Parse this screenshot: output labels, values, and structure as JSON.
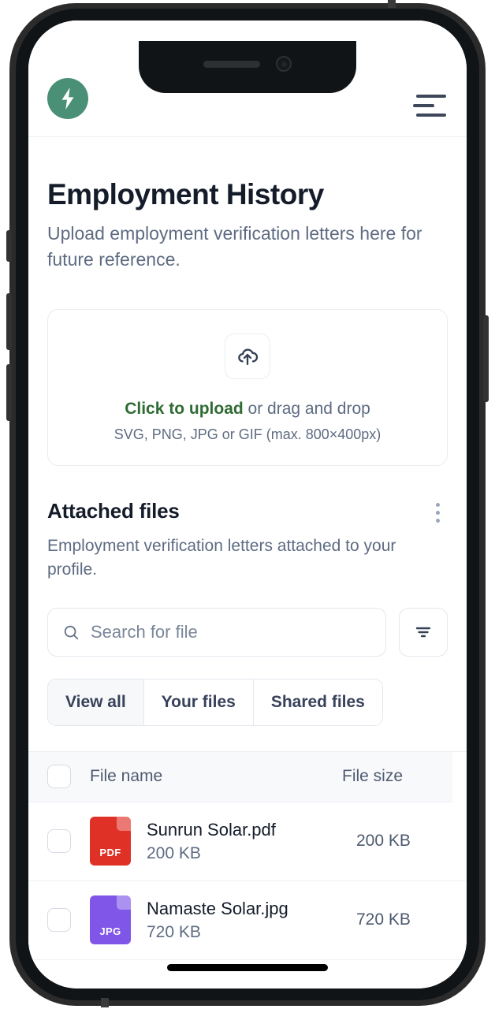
{
  "brand": {
    "logo_icon": "lightning-bolt-icon",
    "logo_color": "#4a9077",
    "menu_icon": "hamburger-menu-icon"
  },
  "page": {
    "title": "Employment History",
    "subtitle": "Upload employment verification letters here for future reference."
  },
  "dropzone": {
    "icon": "cloud-upload-icon",
    "action_label": "Click to upload",
    "action_color": "#2f6b33",
    "rest_label": " or drag and drop",
    "hint": "SVG, PNG, JPG or GIF (max. 800×400px)"
  },
  "attached": {
    "title": "Attached files",
    "subtitle": "Employment verification letters attached to your profile.",
    "menu_icon": "kebab-menu-icon"
  },
  "search": {
    "placeholder": "Search for file",
    "value": "",
    "icon": "search-icon",
    "filter_icon": "filter-lines-icon"
  },
  "tabs": [
    {
      "label": "View all",
      "active": true
    },
    {
      "label": "Your files",
      "active": false
    },
    {
      "label": "Shared files",
      "active": false
    }
  ],
  "table": {
    "columns": {
      "name": "File name",
      "size": "File size"
    },
    "rows": [
      {
        "name": "Sunrun Solar.pdf",
        "subtitle": "200 KB",
        "size": "200 KB",
        "ext": "PDF",
        "color": "#e03127"
      },
      {
        "name": "Namaste Solar.jpg",
        "subtitle": "720 KB",
        "size": "720 KB",
        "ext": "JPG",
        "color": "#7f56e8"
      }
    ]
  }
}
